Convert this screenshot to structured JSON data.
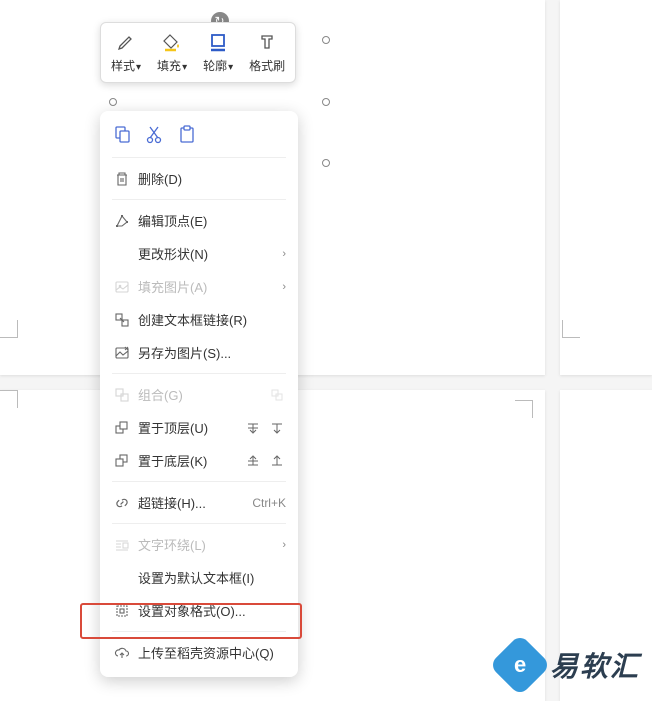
{
  "toolbar": {
    "style_label": "样式",
    "fill_label": "填充",
    "outline_label": "轮廓",
    "format_painter_label": "格式刷"
  },
  "context_menu": {
    "delete": "删除(D)",
    "edit_vertices": "编辑顶点(E)",
    "change_shape": "更改形状(N)",
    "fill_picture": "填充图片(A)",
    "create_textframe_link": "创建文本框链接(R)",
    "save_as_picture": "另存为图片(S)...",
    "group": "组合(G)",
    "bring_to_front": "置于顶层(U)",
    "send_to_back": "置于底层(K)",
    "hyperlink": "超链接(H)...",
    "hyperlink_shortcut": "Ctrl+K",
    "text_wrap": "文字环绕(L)",
    "set_default_textbox": "设置为默认文本框(I)",
    "set_object_format": "设置对象格式(O)...",
    "upload_to_docer": "上传至稻壳资源中心(Q)"
  },
  "logo": {
    "name": "易软汇"
  }
}
